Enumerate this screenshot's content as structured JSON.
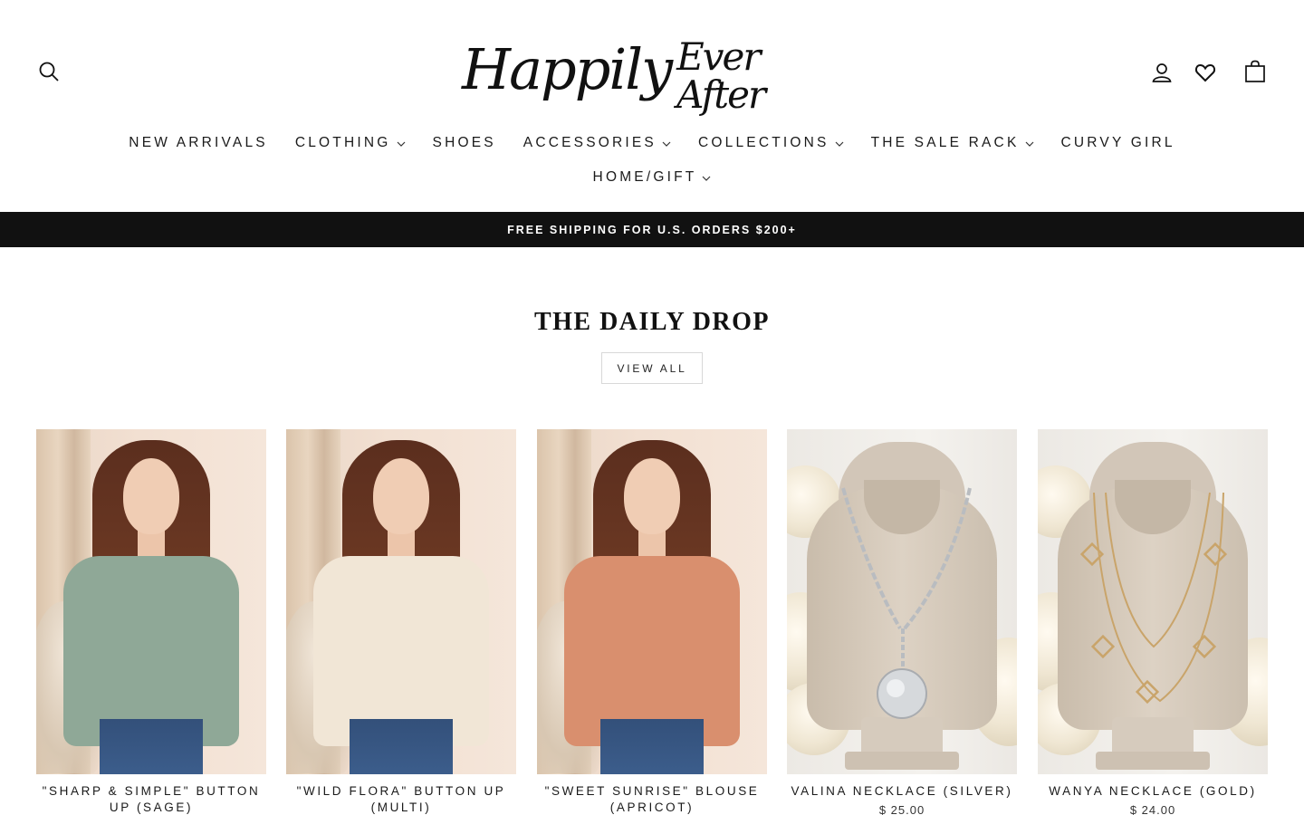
{
  "header": {
    "logo_main": "Happily",
    "logo_sub": "Ever After",
    "icons": [
      "search-icon",
      "account-icon",
      "heart-icon",
      "bag-icon"
    ]
  },
  "nav": {
    "row1": [
      {
        "label": "NEW ARRIVALS",
        "dropdown": false
      },
      {
        "label": "CLOTHING",
        "dropdown": true
      },
      {
        "label": "SHOES",
        "dropdown": false
      },
      {
        "label": "ACCESSORIES",
        "dropdown": true
      },
      {
        "label": "COLLECTIONS",
        "dropdown": true
      },
      {
        "label": "THE SALE RACK",
        "dropdown": true
      },
      {
        "label": "CURVY GIRL",
        "dropdown": false
      }
    ],
    "row2": [
      {
        "label": "HOME/GIFT",
        "dropdown": true
      }
    ]
  },
  "promo": {
    "text": "FREE SHIPPING FOR U.S. ORDERS $200+",
    "background": "#111111"
  },
  "section": {
    "title": "THE DAILY DROP",
    "view_all_label": "VIEW ALL"
  },
  "products": [
    {
      "title": "\"SHARP & SIMPLE\" BUTTON UP (SAGE)",
      "price": "",
      "top_color": "#8fa897"
    },
    {
      "title": "\"WILD FLORA\" BUTTON UP (MULTI)",
      "price": "",
      "top_color": "#f1e6d6"
    },
    {
      "title": "\"SWEET SUNRISE\" BLOUSE (APRICOT)",
      "price": "",
      "top_color": "#d98f6e"
    },
    {
      "title": "VALINA NECKLACE (SILVER)",
      "price": "$ 25.00",
      "top_color": ""
    },
    {
      "title": "WANYA NECKLACE (GOLD)",
      "price": "$ 24.00",
      "top_color": ""
    }
  ]
}
